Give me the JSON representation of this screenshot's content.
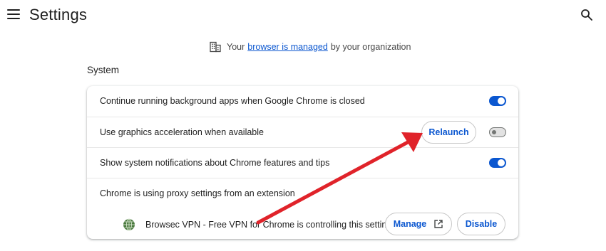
{
  "header": {
    "title": "Settings",
    "menu_icon": "hamburger-menu-icon",
    "search_icon": "search-icon"
  },
  "managed_banner": {
    "prefix": "Your",
    "link": "browser is managed",
    "suffix": "by your organization",
    "icon": "building-icon"
  },
  "section": {
    "title": "System"
  },
  "settings": {
    "background_apps": {
      "label": "Continue running background apps when Google Chrome is closed",
      "enabled": true
    },
    "graphics_accel": {
      "label": "Use graphics acceleration when available",
      "enabled": false,
      "relaunch_label": "Relaunch"
    },
    "notifications": {
      "label": "Show system notifications about Chrome features and tips",
      "enabled": true
    },
    "proxy": {
      "label": "Chrome is using proxy settings from an extension",
      "extension_text": "Browsec VPN - Free VPN for Chrome is controlling this setting",
      "manage_label": "Manage",
      "disable_label": "Disable",
      "extension_icon": "globe-icon"
    }
  },
  "colors": {
    "accent": "#0b57d0",
    "annotation_arrow": "#e0232a"
  }
}
